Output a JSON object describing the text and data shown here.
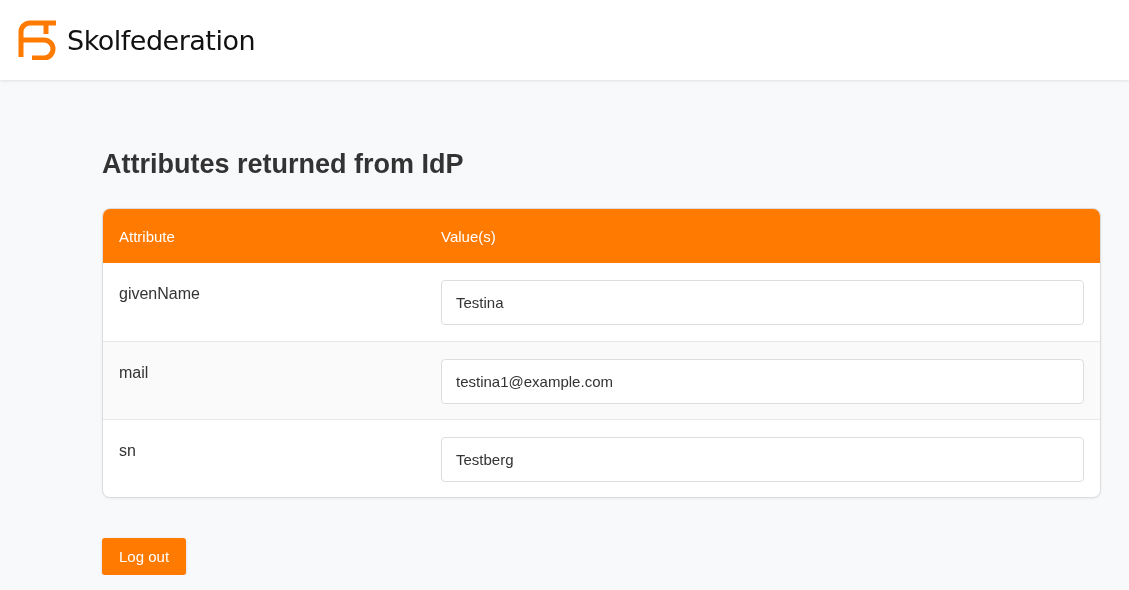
{
  "header": {
    "brand": "Skolfederation"
  },
  "heading": "Attributes returned from IdP",
  "table": {
    "columns": [
      "Attribute",
      "Value(s)"
    ],
    "rows": [
      {
        "attribute": "givenName",
        "value": "Testina"
      },
      {
        "attribute": "mail",
        "value": "testina1@example.com"
      },
      {
        "attribute": "sn",
        "value": "Testberg"
      }
    ]
  },
  "buttons": [
    "Log out"
  ]
}
